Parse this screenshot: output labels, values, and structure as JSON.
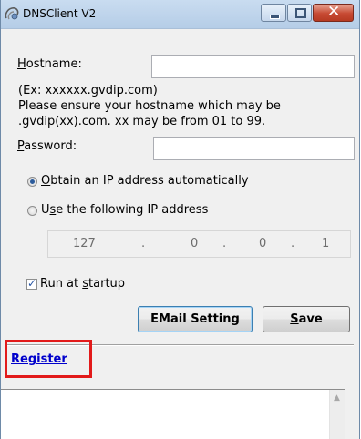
{
  "window": {
    "title": "DNSClient V2",
    "close_glyph": "✕"
  },
  "form": {
    "hostname_label_u": "H",
    "hostname_label_rest": "ostname:",
    "hostname_value": "",
    "hint_line1": "(Ex: xxxxxx.gvdip.com)",
    "hint_line2": "Please ensure your hostname which may be",
    "hint_line3": ".gvdip(xx).com. xx may be from 01 to 99.",
    "password_label_u": "P",
    "password_label_rest": "assword:",
    "password_value": "",
    "radio_auto_u": "O",
    "radio_auto_rest": "btain an IP address automatically",
    "radio_auto_selected": true,
    "radio_manual_pre": "U",
    "radio_manual_u": "s",
    "radio_manual_rest": "e the following IP address",
    "ip": [
      "127",
      "0",
      "0",
      "1"
    ],
    "ip_dot": ".",
    "startup_pre": "Run at ",
    "startup_u": "s",
    "startup_rest": "tartup",
    "startup_checked": true
  },
  "buttons": {
    "email_setting": "EMail Setting",
    "save_u": "S",
    "save_rest": "ave"
  },
  "links": {
    "register": "Register"
  },
  "colors": {
    "highlight": "#e21a1a",
    "link": "#0000cc"
  }
}
